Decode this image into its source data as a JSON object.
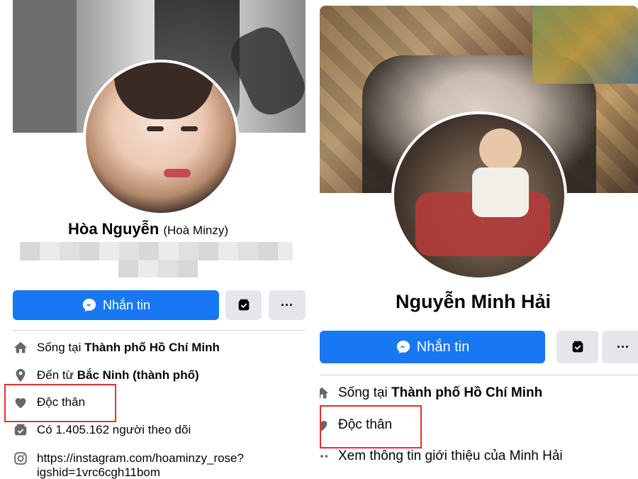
{
  "left": {
    "name": "Hòa Nguyễn",
    "alt_name": "(Hoà Minzy)",
    "message_button": "Nhắn tin",
    "more_button": "···",
    "lives_in_prefix": "Sống tại ",
    "lives_in_place": "Thành phố Hồ Chí Minh",
    "from_prefix": "Đến từ ",
    "from_place": "Bắc Ninh (thành phố)",
    "relationship": "Độc thân",
    "followers": "Có 1.405.162 người theo dõi",
    "instagram_line1": "https://instagram.com/hoaminzy_rose?",
    "instagram_line2": "igshid=1vrc6cgh11bom"
  },
  "right": {
    "name": "Nguyễn Minh Hải",
    "message_button": "Nhắn tin",
    "more_button": "···",
    "lives_in_prefix": "Sống tại ",
    "lives_in_place": "Thành phố Hồ Chí Minh",
    "relationship": "Độc thân",
    "see_more": "Xem thông tin giới thiệu của Minh Hải"
  },
  "colors": {
    "primary": "#1877f2",
    "secondary_button": "#e4e6eb",
    "highlight_box": "#e4322b",
    "icon": "#65676b"
  },
  "icons": [
    "messenger-icon",
    "shop-icon",
    "more-icon",
    "home-icon",
    "location-pin-icon",
    "heart-icon",
    "followers-icon",
    "instagram-icon"
  ]
}
